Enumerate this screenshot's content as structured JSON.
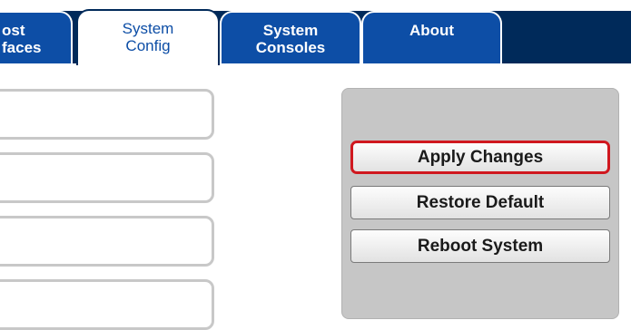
{
  "tabs": [
    {
      "id": "host-interfaces",
      "line1": "ost",
      "line2": "faces",
      "active": false
    },
    {
      "id": "system-config",
      "line1": "System",
      "line2": "Config",
      "active": true
    },
    {
      "id": "system-consoles",
      "line1": "System",
      "line2": "Consoles",
      "active": false
    },
    {
      "id": "about",
      "line1": "About",
      "line2": "",
      "active": false
    }
  ],
  "actions": {
    "apply_label": "Apply Changes",
    "restore_label": "Restore Default",
    "reboot_label": "Reboot System"
  },
  "colors": {
    "tab_bar": "#002a5a",
    "tab": "#0d4ea6",
    "panel": "#c6c6c6",
    "highlight": "#d0181f"
  }
}
